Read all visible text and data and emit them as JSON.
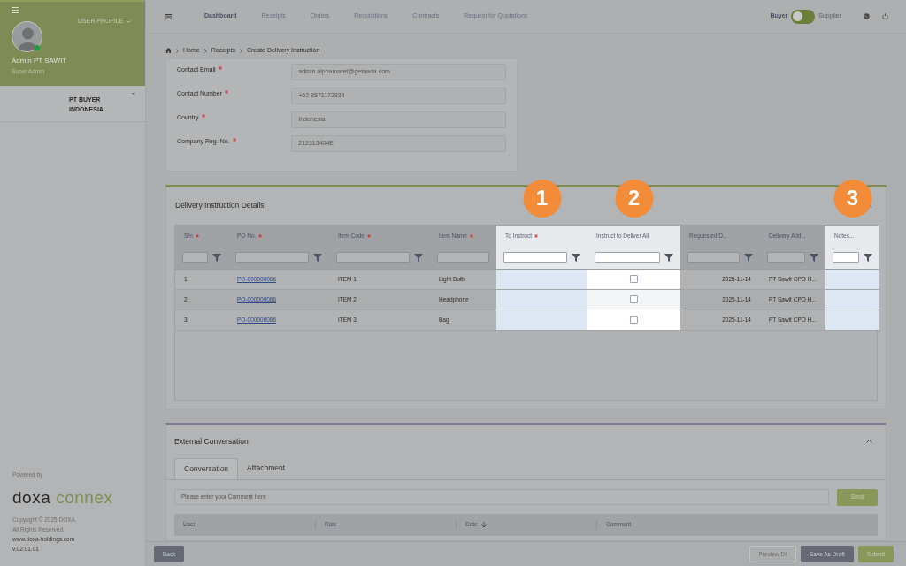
{
  "sidebar": {
    "profile_menu": "USER PROFILE",
    "user_name": "Admin PT SAWIT",
    "user_role": "Super Admin",
    "online": true,
    "company": "PT BUYER INDONESIA",
    "powered_by": "Powered by",
    "brand_first": "doxa",
    "brand_second": "connex",
    "copyright": "Copyright © 2025 DOXA.",
    "rights": "All Rights Reserved.",
    "website": "www.doxa-holdings.com",
    "version": "v.02.01.01"
  },
  "nav": {
    "items": [
      {
        "label": "Dashboard",
        "selected": true
      },
      {
        "label": "Receipts",
        "selected": false
      },
      {
        "label": "Orders",
        "selected": false
      },
      {
        "label": "Requisitions",
        "selected": false
      },
      {
        "label": "Contracts",
        "selected": false
      },
      {
        "label": "Request for Quotations",
        "selected": false
      }
    ],
    "role_left": "Buyer",
    "role_right": "Supplier",
    "supplier_on": false
  },
  "breadcrumb": [
    "Home",
    "Receipts",
    "Create Delivery Instruction"
  ],
  "company_fields": [
    {
      "label": "Contact Email",
      "required": true,
      "value": "admin.alphamaret@getnada.com"
    },
    {
      "label": "Contact Number",
      "required": true,
      "value": "+62 8571172934"
    },
    {
      "label": "Country",
      "required": true,
      "value": "Indonesia"
    },
    {
      "label": "Company Reg. No.",
      "required": true,
      "value": "212313404E"
    }
  ],
  "delivery": {
    "title": "Delivery Instruction Details",
    "expanded": true,
    "columns": [
      {
        "label": "S/n",
        "required": true,
        "highlighted": false,
        "filter_button": true
      },
      {
        "label": "PO No.",
        "required": true,
        "highlighted": false,
        "filter_button": true
      },
      {
        "label": "Item Code",
        "required": true,
        "highlighted": false,
        "filter_button": true
      },
      {
        "label": "Item Name",
        "required": true,
        "highlighted": false,
        "filter_button": false
      },
      {
        "label": "To Instruct",
        "required": true,
        "highlighted": true,
        "filter_button": true,
        "callout": "1"
      },
      {
        "label": "Instruct to Deliver All",
        "required": false,
        "highlighted": true,
        "filter_button": true,
        "callout": "2"
      },
      {
        "label": "Requested D...",
        "required": false,
        "highlighted": false,
        "filter_button": true
      },
      {
        "label": "Delivery Add...",
        "required": false,
        "highlighted": false,
        "filter_button": true
      },
      {
        "label": "Notes...",
        "required": false,
        "highlighted": true,
        "filter_button": true,
        "callout": "3"
      }
    ],
    "rows": [
      {
        "sn": "1",
        "po": "PO-000000086",
        "item_code": "ITEM 1",
        "item_name": "Light Bulb",
        "deliver_all": false,
        "requested_date": "2025-11-14",
        "delivery_address": "PT Sawit CPO H..."
      },
      {
        "sn": "2",
        "po": "PO-000000086",
        "item_code": "ITEM 2",
        "item_name": "Headphone",
        "deliver_all": false,
        "requested_date": "2025-11-14",
        "delivery_address": "PT Sawit CPO H..."
      },
      {
        "sn": "3",
        "po": "PO-000000086",
        "item_code": "ITEM 3",
        "item_name": "Bag",
        "deliver_all": false,
        "requested_date": "2025-11-14",
        "delivery_address": "PT Sawit CPO H..."
      }
    ]
  },
  "conversation": {
    "title": "External Conversation",
    "expanded": true,
    "tabs": [
      {
        "label": "Conversation",
        "selected": true
      },
      {
        "label": "Attachment",
        "selected": false
      }
    ],
    "comment_placeholder": "Please enter your Comment here",
    "send": "Send",
    "columns": [
      {
        "label": "User",
        "sorted": false
      },
      {
        "label": "Role",
        "sorted": false
      },
      {
        "label": "Date",
        "sorted": true
      },
      {
        "label": "Comment",
        "sorted": false
      }
    ]
  },
  "footer": {
    "buttons": [
      {
        "label": "Back",
        "kind": "dark"
      },
      {
        "label": "Preview DI",
        "kind": "outline"
      },
      {
        "label": "Save As Draft",
        "kind": "dark"
      },
      {
        "label": "Submit",
        "kind": "green"
      }
    ]
  }
}
